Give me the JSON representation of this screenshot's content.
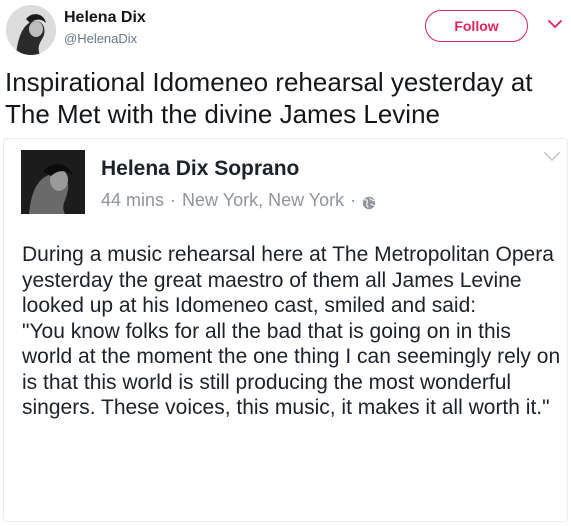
{
  "tweet": {
    "author": {
      "name": "Helena Dix",
      "handle": "@HelenaDix"
    },
    "follow_label": "Follow",
    "accent_color": "#e0245e",
    "text": "Inspirational Idomeneo rehearsal yesterday at The Met with the divine James Levine"
  },
  "embedded_post": {
    "author_name": "Helena Dix Soprano",
    "time": "44 mins",
    "separator": "·",
    "location": "New York, New York",
    "privacy_icon": "globe-icon",
    "paragraphs": [
      "During a music rehearsal here at The Metropolitan Opera yesterday the great maestro of them all James Levine looked up at his Idomeneo cast, smiled and said:",
      "\"You know folks for all the bad that is going on in this world at the moment the one thing I can seemingly rely on is that this world is still producing the most wonderful singers. These voices, this music, it makes it all worth it.\""
    ]
  }
}
